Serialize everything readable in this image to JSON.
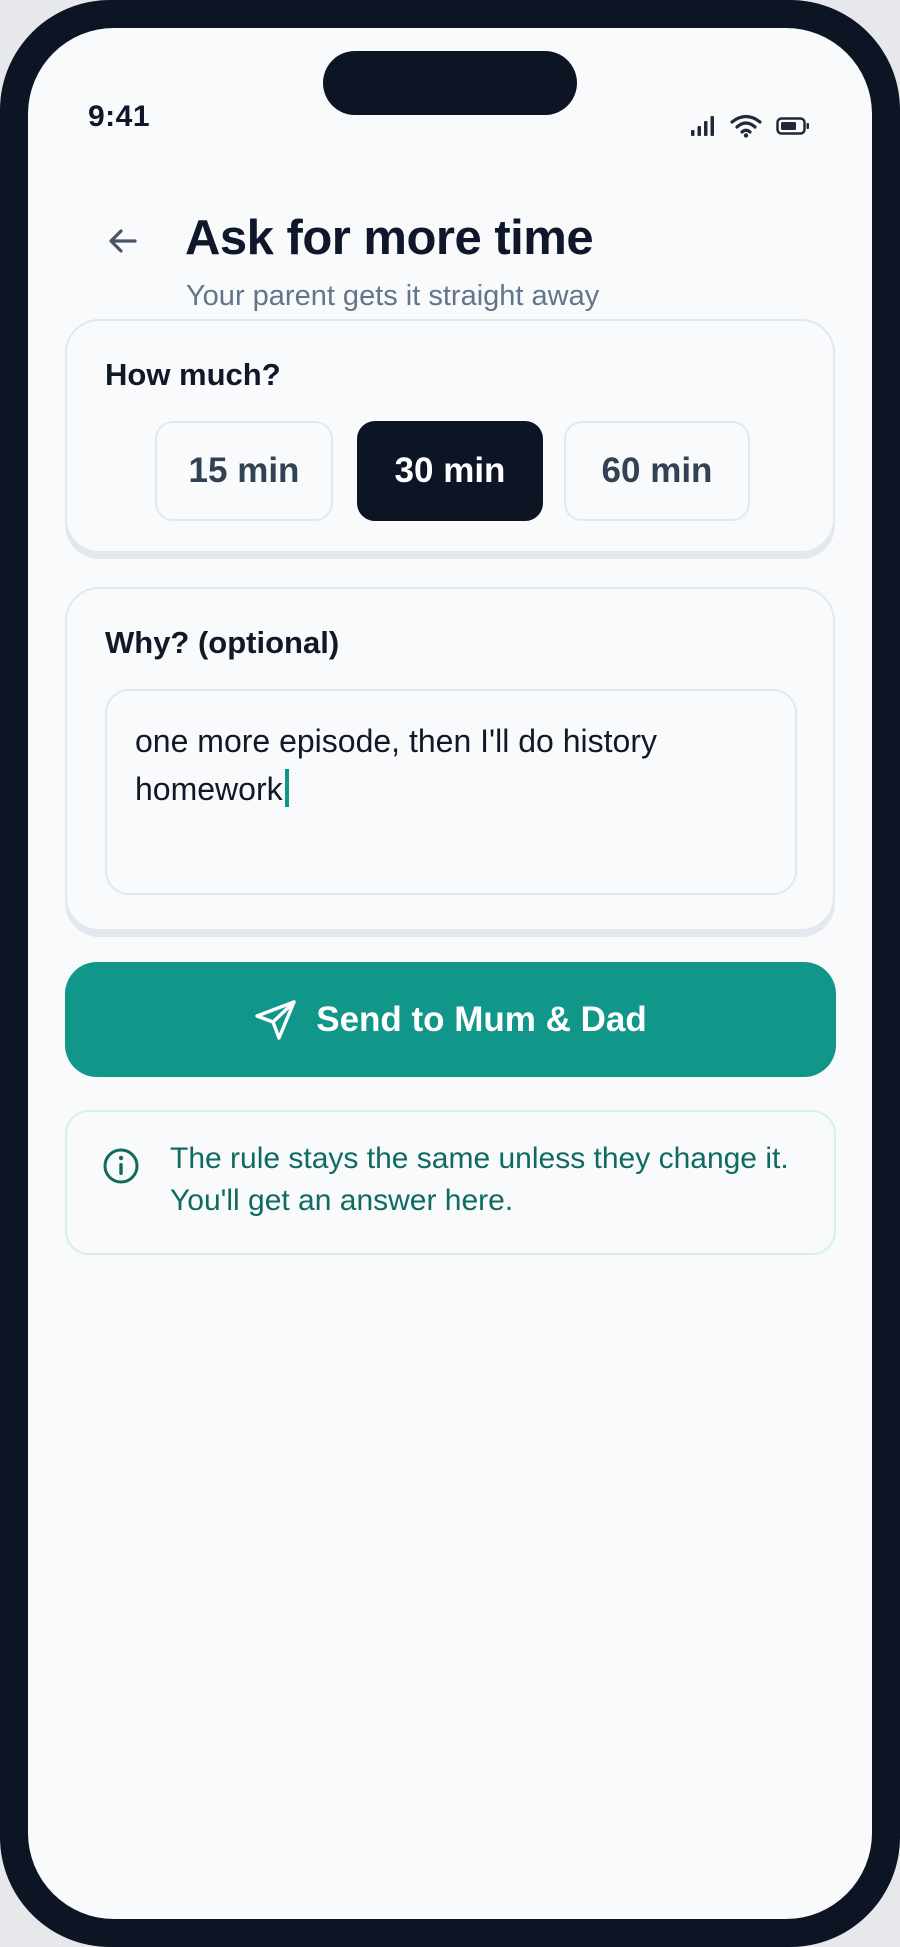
{
  "status_bar": {
    "time": "9:41",
    "icons": [
      "cellular-signal-icon",
      "wifi-icon",
      "battery-icon"
    ]
  },
  "header": {
    "title": "Ask for more time",
    "subtitle": "Your parent gets it straight away",
    "back_icon": "arrow-left-icon"
  },
  "amount": {
    "label": "How much?",
    "options": [
      {
        "label": "15 min",
        "selected": false
      },
      {
        "label": "30 min",
        "selected": true
      },
      {
        "label": "60 min",
        "selected": false
      }
    ]
  },
  "reason": {
    "label": "Why? (optional)",
    "value": "one more episode, then I'll do history homework"
  },
  "send": {
    "label": "Send to Mum & Dad",
    "icon": "paper-plane-icon"
  },
  "info": {
    "icon": "info-circle-icon",
    "text": "The rule stays the same unless they change it. You'll get an answer here."
  },
  "colors": {
    "accent": "#11968a",
    "dark": "#0d1423",
    "background": "#f8fafc",
    "info_text": "#0f6b5f"
  }
}
